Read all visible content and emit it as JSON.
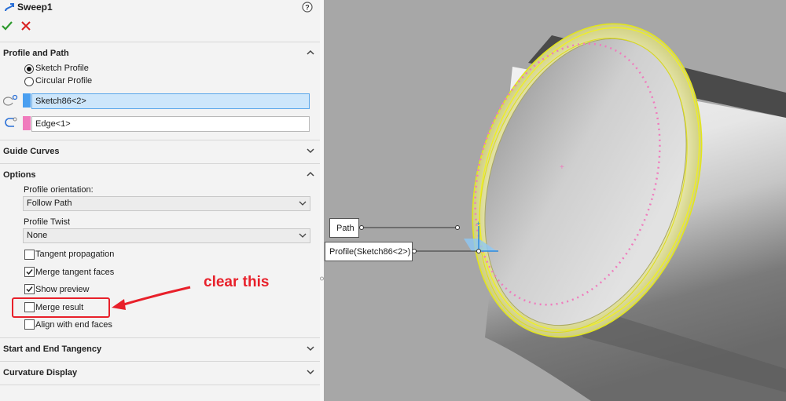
{
  "feature": {
    "title": "Sweep1"
  },
  "sections": {
    "profile_path": {
      "label": "Profile and Path"
    },
    "guide_curves": {
      "label": "Guide Curves"
    },
    "options": {
      "label": "Options"
    },
    "tangency": {
      "label": "Start and End Tangency"
    },
    "curvature": {
      "label": "Curvature Display"
    }
  },
  "profile_type": {
    "sketch": "Sketch Profile",
    "circular": "Circular Profile",
    "selected": "Sketch Profile"
  },
  "profile_field": {
    "value": "Sketch86<2>",
    "color": "#4a9ff0"
  },
  "path_field": {
    "value": "Edge<1>",
    "color": "#f07bbd"
  },
  "options": {
    "orientation_label": "Profile orientation:",
    "orientation_value": "Follow Path",
    "twist_label": "Profile Twist",
    "twist_value": "None",
    "checkboxes": [
      {
        "label": "Tangent propagation",
        "checked": false
      },
      {
        "label": "Merge tangent faces",
        "checked": true
      },
      {
        "label": "Show preview",
        "checked": true
      },
      {
        "label": "Merge result",
        "checked": false
      },
      {
        "label": "Align with end faces",
        "checked": false
      }
    ]
  },
  "annotation": {
    "text": "clear this",
    "color": "#e8202a"
  },
  "viewport": {
    "path_callout": "Path",
    "profile_callout": "Profile(Sketch86<2>)"
  },
  "icons": [
    "sweep-icon",
    "help-icon",
    "ok-icon",
    "cancel-icon",
    "profile-icon",
    "path-icon"
  ]
}
